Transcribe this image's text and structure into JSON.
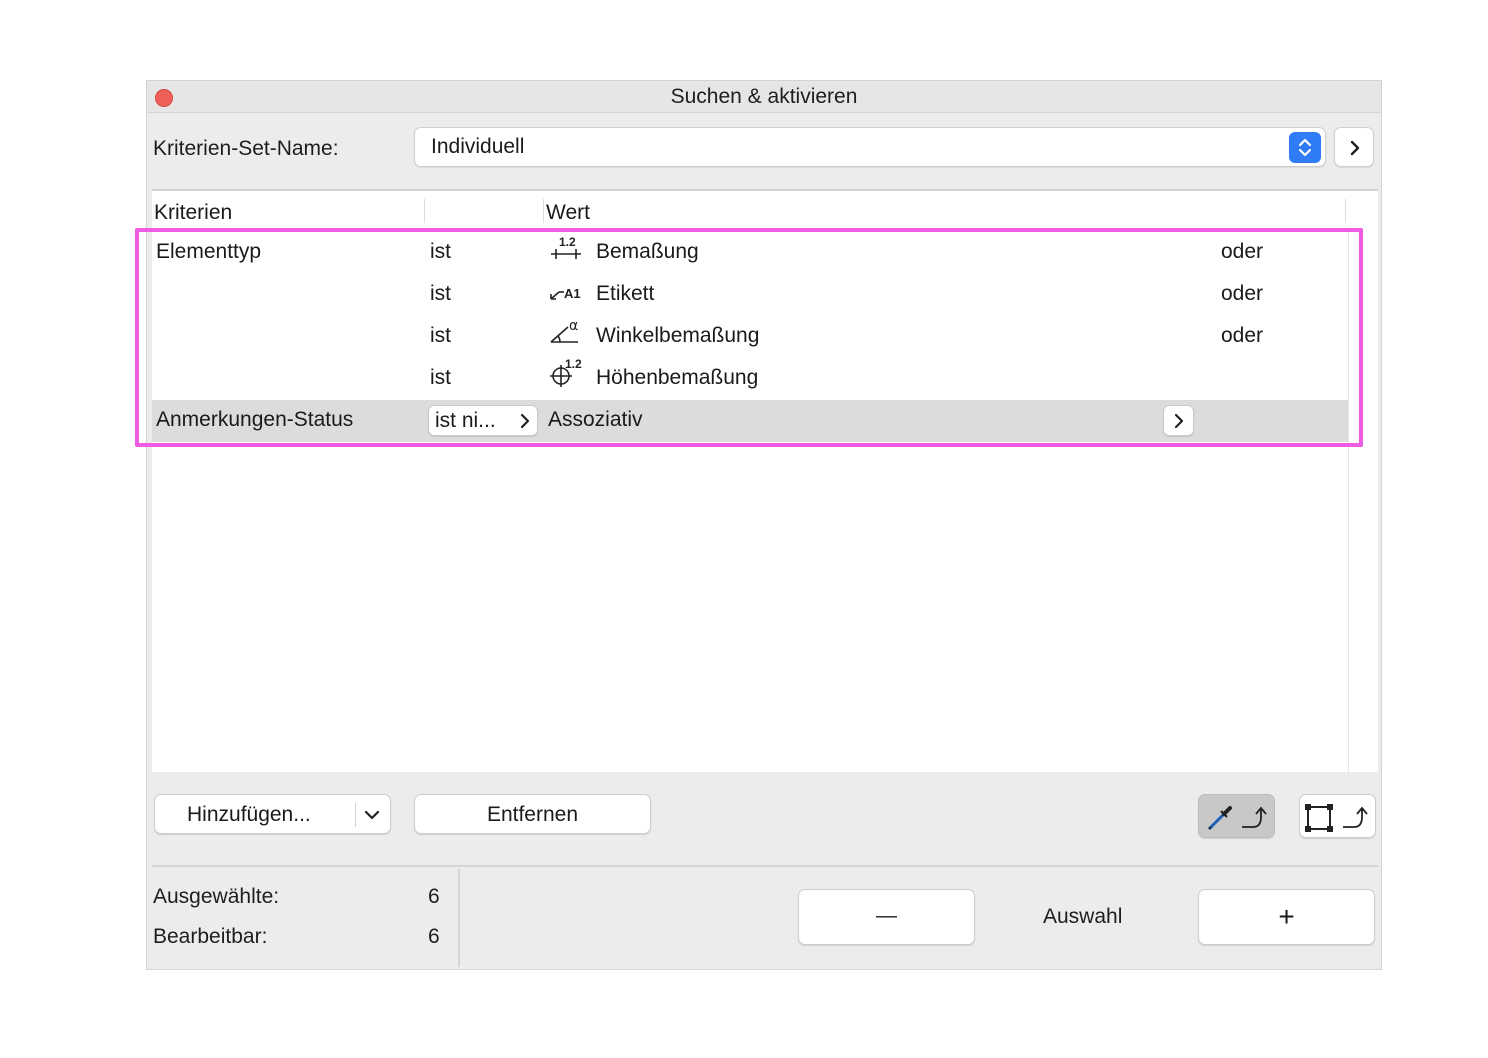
{
  "window": {
    "title": "Suchen & aktivieren"
  },
  "criteria_set": {
    "label": "Kriterien-Set-Name:",
    "value": "Individuell"
  },
  "table": {
    "headers": [
      "Kriterien",
      "Wert"
    ],
    "rows": [
      {
        "criterion": "Elementtyp",
        "operator": "ist",
        "icon": "dimension-icon",
        "value": "Bemaßung",
        "logic": "oder"
      },
      {
        "criterion": "",
        "operator": "ist",
        "icon": "label-icon",
        "value": "Etikett",
        "logic": "oder"
      },
      {
        "criterion": "",
        "operator": "ist",
        "icon": "angle-dimension-icon",
        "value": "Winkelbemaßung",
        "logic": "oder"
      },
      {
        "criterion": "",
        "operator": "ist",
        "icon": "level-dimension-icon",
        "value": "Höhenbemaßung",
        "logic": ""
      },
      {
        "criterion": "Anmerkungen-Status",
        "operator": "ist ni...",
        "icon": "",
        "value": "Assoziativ",
        "logic": ""
      }
    ]
  },
  "buttons": {
    "add": "Hinzufügen...",
    "remove": "Entfernen"
  },
  "stats": {
    "selected_label": "Ausgewählte:",
    "selected_value": "6",
    "editable_label": "Bearbeitbar:",
    "editable_value": "6"
  },
  "selection": {
    "label": "Auswahl",
    "minus": "—",
    "plus": "+"
  },
  "colors": {
    "highlight": "#ee5ce6",
    "accent": "#2f7cf6",
    "close": "#ed5f57"
  }
}
